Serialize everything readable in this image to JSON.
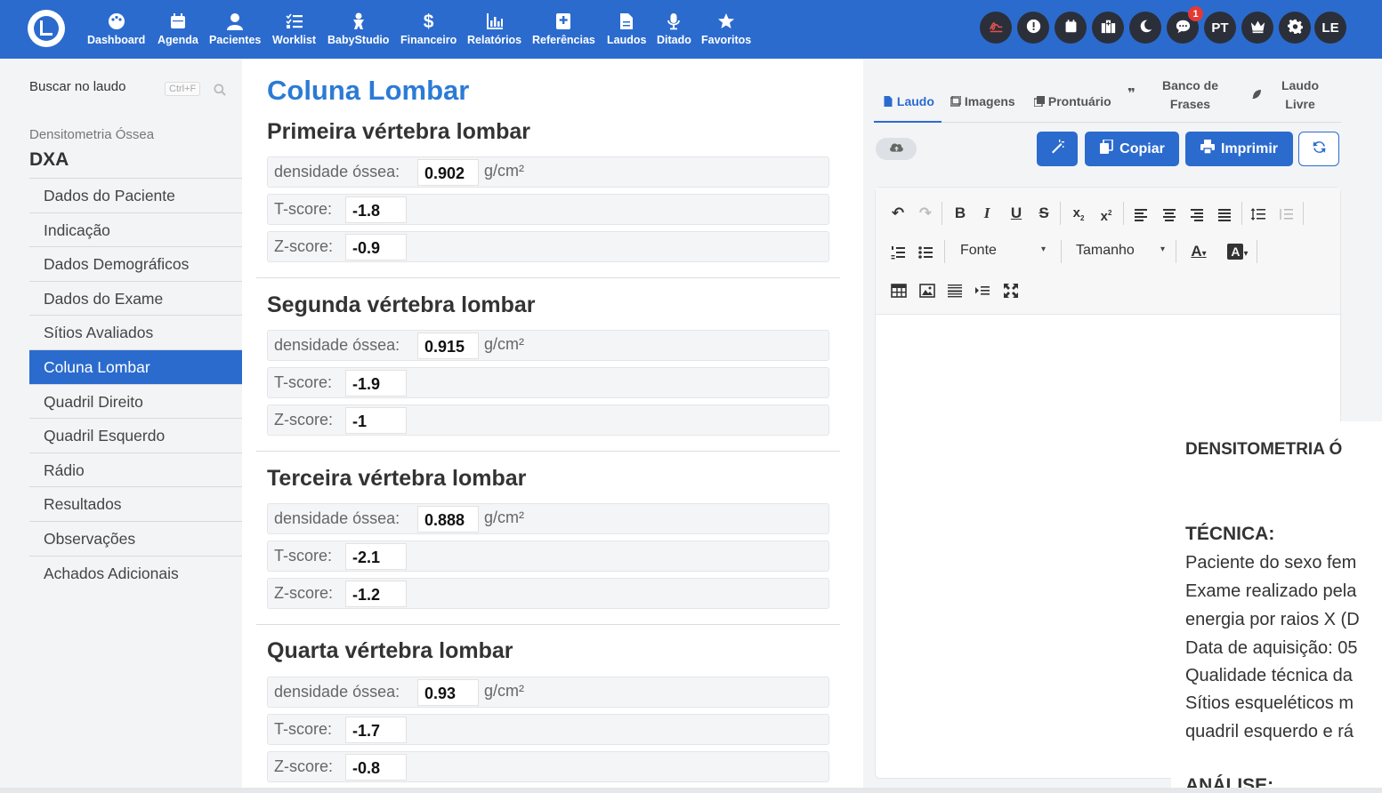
{
  "navbar": {
    "items": [
      {
        "label": "Dashboard",
        "icon": "palette-icon"
      },
      {
        "label": "Agenda",
        "icon": "calendar-icon"
      },
      {
        "label": "Pacientes",
        "icon": "user-icon"
      },
      {
        "label": "Worklist",
        "icon": "list-check-icon"
      },
      {
        "label": "BabyStudio",
        "icon": "baby-icon"
      },
      {
        "label": "Financeiro",
        "icon": "dollar-icon"
      },
      {
        "label": "Relatórios",
        "icon": "chart-icon"
      },
      {
        "label": "Referências",
        "icon": "medical-book-icon"
      },
      {
        "label": "Laudos",
        "icon": "document-icon"
      },
      {
        "label": "Ditado",
        "icon": "microphone-icon"
      },
      {
        "label": "Favoritos",
        "icon": "star-icon"
      }
    ],
    "right": {
      "notification_count": "1",
      "language": "PT",
      "user_initials": "LE"
    }
  },
  "sidebar": {
    "search_label": "Buscar no laudo",
    "search_shortcut": "Ctrl+F",
    "section_subtitle": "Densitometria Óssea",
    "section_title": "DXA",
    "items": [
      {
        "label": "Dados do Paciente"
      },
      {
        "label": "Indicação"
      },
      {
        "label": "Dados Demográficos"
      },
      {
        "label": "Dados do Exame"
      },
      {
        "label": "Sítios Avaliados"
      },
      {
        "label": "Coluna Lombar"
      },
      {
        "label": "Quadril Direito"
      },
      {
        "label": "Quadril Esquerdo"
      },
      {
        "label": "Rádio"
      },
      {
        "label": "Resultados"
      },
      {
        "label": "Observações"
      },
      {
        "label": "Achados Adicionais"
      }
    ]
  },
  "main": {
    "title": "Coluna Lombar",
    "labels": {
      "density": "densidade óssea:",
      "unit": "g/cm²",
      "tscore": "T-score:",
      "zscore": "Z-score:"
    },
    "vertebrae": [
      {
        "title": "Primeira vértebra lombar",
        "density": "0.902",
        "tscore": "-1.8",
        "zscore": "-0.9"
      },
      {
        "title": "Segunda vértebra lombar",
        "density": "0.915",
        "tscore": "-1.9",
        "zscore": "-1"
      },
      {
        "title": "Terceira vértebra lombar",
        "density": "0.888",
        "tscore": "-2.1",
        "zscore": "-1.2"
      },
      {
        "title": "Quarta vértebra lombar",
        "density": "0.93",
        "tscore": "-1.7",
        "zscore": "-0.8"
      }
    ]
  },
  "right_panel": {
    "tabs": {
      "laudo": "Laudo",
      "imagens": "Imagens",
      "prontuario": "Prontuário",
      "banco_line1": "Banco de",
      "banco_line2": "Frases",
      "livre_line1": "Laudo",
      "livre_line2": "Livre"
    },
    "buttons": {
      "copy": "Copiar",
      "print": "Imprimir"
    },
    "editor": {
      "font_select": "Fonte",
      "size_select": "Tamanho"
    }
  },
  "document": {
    "lines": [
      "DENSITOMETRIA Ó",
      "TÉCNICA:",
      "Paciente do sexo fem",
      "Exame realizado pela",
      "energia por raios X (D",
      "Data de aquisição: 05",
      "Qualidade técnica da",
      "Sítios esqueléticos m",
      "quadril esquerdo e rá",
      "ANÁLISE:"
    ]
  }
}
